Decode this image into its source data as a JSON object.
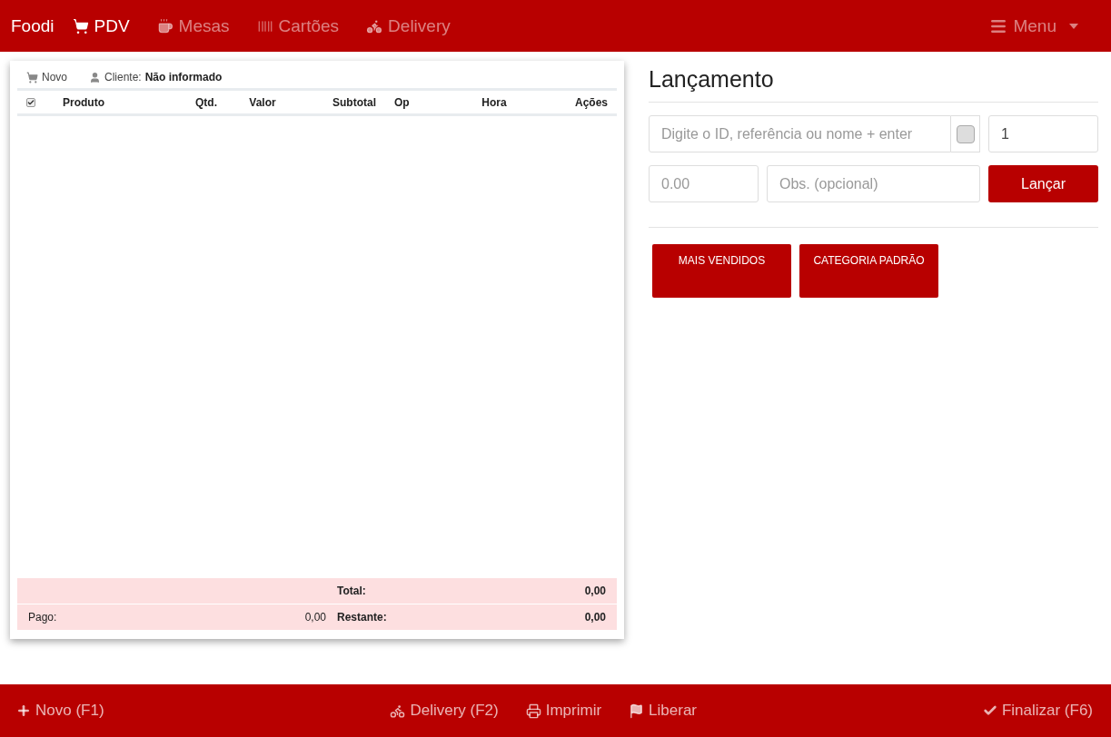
{
  "navbar": {
    "brand": "Foodi",
    "items": [
      {
        "label": "PDV",
        "selected": true
      },
      {
        "label": "Mesas",
        "selected": false
      },
      {
        "label": "Cartões",
        "selected": false
      },
      {
        "label": "Delivery",
        "selected": false
      }
    ],
    "menu": "Menu"
  },
  "order": {
    "new_label": "Novo",
    "client_label": "Cliente:",
    "client_value": "Não informado",
    "select_all_checked": true,
    "columns": [
      "Produto",
      "Qtd.",
      "Valor",
      "Subtotal",
      "Op",
      "Hora",
      "Ações"
    ],
    "total_label": "Total:",
    "total_value": "0,00",
    "paid_label": "Pago:",
    "paid_value": "0,00",
    "remaining_label": "Restante:",
    "remaining_value": "0,00"
  },
  "launch": {
    "title": "Lançamento",
    "search_placeholder": "Digite o ID, referência ou nome + enter",
    "search_checked": false,
    "quantity": "1",
    "price_placeholder": "0.00",
    "note_placeholder": "Obs. (opcional)",
    "submit": "Lançar",
    "categories": [
      "MAIS VENDIDOS",
      "CATEGORIA PADRÃO"
    ]
  },
  "footer": {
    "left": [
      "Novo (F1)"
    ],
    "center": [
      "Delivery (F2)",
      "Imprimir",
      "Liberar"
    ],
    "right": [
      "Finalizar (F6)"
    ]
  }
}
